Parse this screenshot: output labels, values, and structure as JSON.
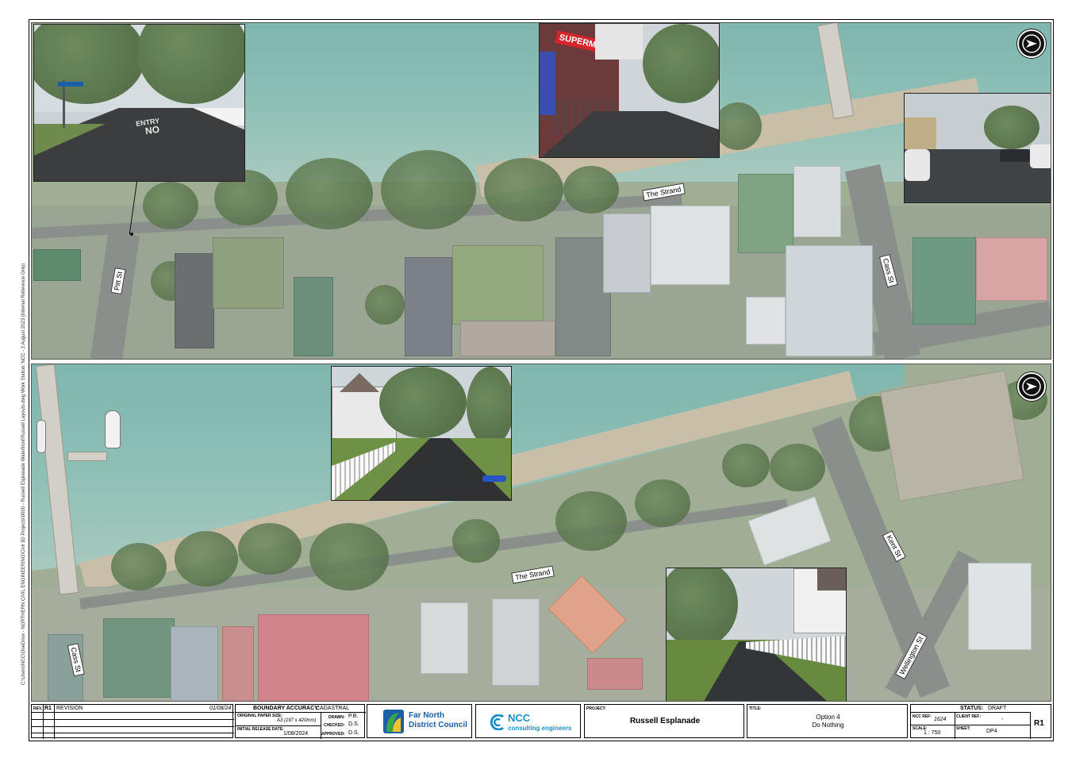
{
  "map": {
    "streets": {
      "pitt_st": "Pitt St",
      "the_strand_top": "The Strand",
      "cass_st_top": "Cass St",
      "the_strand_bottom": "The Strand",
      "cass_st_bottom": "Cass St",
      "kent_st": "Kent St",
      "wellington_st": "Wellington St"
    },
    "photo_sign": {
      "entry": "ENTRY",
      "no": "NO"
    },
    "shop_sign": "SUPERMARKET"
  },
  "sidebar_path": "C:\\Users\\NCC\\OneDrive - NORTHERN CIVIL ENGINEERING\\Civil 3D Projects\\0000 - Russell Esplanade Waterfront\\Russell Layouts.dwg   Work Station: NCC - 2 August 2023  (Internal Reference Only)",
  "title_block": {
    "rev_head": "REV.",
    "rev": "R1",
    "revision_head": "REVISION",
    "revision_date": "01/08/24",
    "boundary_label": "BOUNDARY ACCURACY:",
    "boundary_value": "CADASTRAL",
    "paper_label": "ORIGINAL PAPER SIZE:",
    "paper_value": "A3 (297 x 420mm)",
    "release_label": "INITIAL RELEASE DATE:",
    "release_value": "1/08/2024",
    "drawn_label": "DRAWN:",
    "drawn_value": "P.B.",
    "checked_label": "CHECKED:",
    "checked_value": "D.S.",
    "approved_label": "APPROVED:",
    "approved_value": "D.S.",
    "fndc_line1": "Far North",
    "fndc_line2": "District Council",
    "ncc_big": "NCC",
    "ncc_sub": "consulting engineers",
    "project_label": "PROJECT:",
    "project_value": "Russell Esplanade",
    "title_label": "TITLE:",
    "title_line1": "Option 4",
    "title_line2": "Do Nothing",
    "status_label": "STATUS:",
    "status_value": "DRAFT",
    "ncc_ref_label": "NCC REF:",
    "ncc_ref_value": "1624",
    "client_ref_label": "CLIENT REF:",
    "client_ref_value": "-",
    "scale_label": "SCALE:",
    "scale_value": "1 : 750",
    "sheet_label": "SHEET:",
    "sheet_value": "DP4",
    "rev_big": "R1"
  },
  "colors": {
    "water": "#8fc0b6",
    "fndc_blue": "#1b5fa8",
    "fndc_green": "#3aa845",
    "ncc_blue": "#1a8fc8"
  },
  "icons": [
    "north-arrow-icon",
    "fndc-logo-icon",
    "ncc-logo-icon"
  ]
}
